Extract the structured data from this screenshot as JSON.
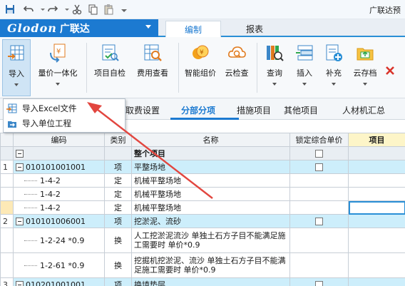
{
  "app": {
    "title": "广联达预"
  },
  "brand": {
    "logo_text": "Glodon",
    "name": "广联达"
  },
  "menu_tabs": [
    {
      "label": "编制"
    },
    {
      "label": "报表"
    }
  ],
  "ribbon": [
    {
      "label": "导入"
    },
    {
      "label": "量价一体化"
    },
    {
      "label": "项目自检"
    },
    {
      "label": "费用查看"
    },
    {
      "label": "智能组价"
    },
    {
      "label": "云检查"
    },
    {
      "label": "查询"
    },
    {
      "label": "插入"
    },
    {
      "label": "补充"
    },
    {
      "label": "云存档"
    }
  ],
  "import_menu": [
    {
      "label": "导入Excel文件"
    },
    {
      "label": "导入单位工程"
    }
  ],
  "sub_tabs": [
    {
      "label": "取费设置"
    },
    {
      "label": "分部分项"
    },
    {
      "label": "措施项目"
    },
    {
      "label": "其他项目"
    },
    {
      "label": "人材机汇总"
    }
  ],
  "table": {
    "columns": [
      "编码",
      "类别",
      "名称",
      "锁定综合单价",
      "项目"
    ],
    "rows": [
      {
        "num": "",
        "code": "",
        "type": "",
        "name": "整个项目"
      },
      {
        "num": "1",
        "code": "010101001001",
        "type": "项",
        "name": "平整场地"
      },
      {
        "num": "",
        "code": "1-4-2",
        "type": "定",
        "name": "机械平整场地"
      },
      {
        "num": "",
        "code": "1-4-2",
        "type": "定",
        "name": "机械平整场地"
      },
      {
        "num": "",
        "code": "1-4-2",
        "type": "定",
        "name": "机械平整场地"
      },
      {
        "num": "2",
        "code": "010101006001",
        "type": "项",
        "name": "挖淤泥、流砂"
      },
      {
        "num": "",
        "code": "1-2-24 *0.9",
        "type": "换",
        "name": "人工挖淤泥流沙  单独土石方子目不能满足施工需要时 单价*0.9"
      },
      {
        "num": "",
        "code": "1-2-61 *0.9",
        "type": "换",
        "name": "挖掘机挖淤泥、流沙  单独土石方子目不能满足施工需要时 单价*0.9"
      },
      {
        "num": "3",
        "code": "010201001001",
        "type": "项",
        "name": "换填垫层"
      }
    ]
  },
  "colors": {
    "accent": "#1c7ad1",
    "row_highlight": "#cdeefb",
    "arrow": "#e2463f"
  }
}
